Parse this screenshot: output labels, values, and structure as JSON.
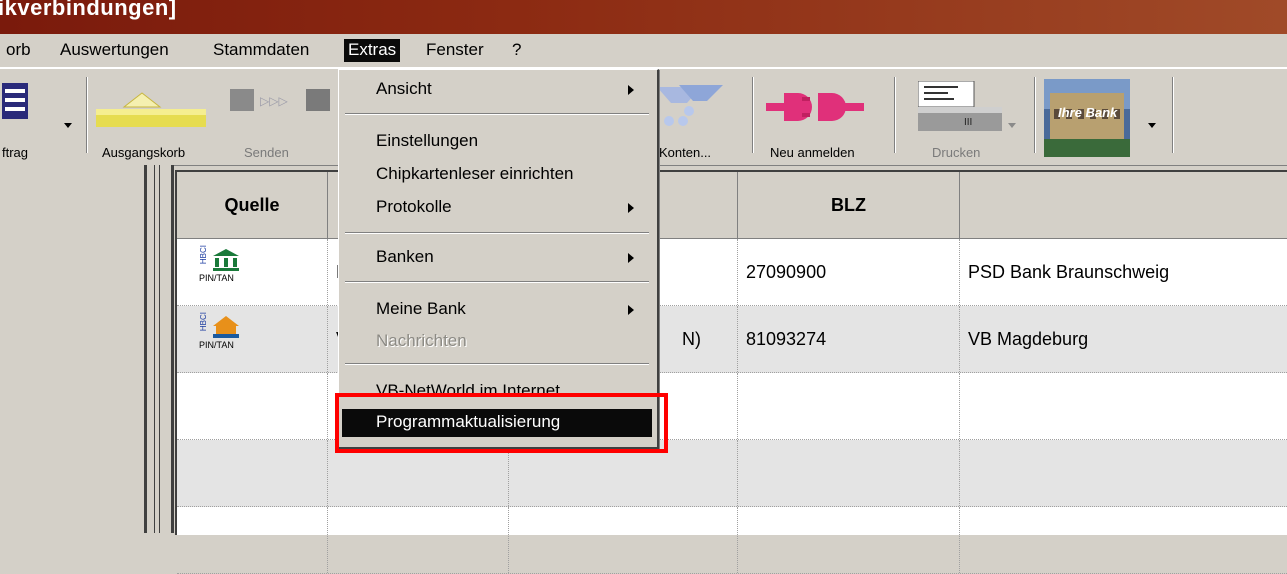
{
  "window": {
    "title": "ikverbindungen]"
  },
  "menubar": {
    "items": [
      {
        "label": "orb"
      },
      {
        "label": "Auswertungen"
      },
      {
        "label": "Stammdaten"
      },
      {
        "label": "Extras"
      },
      {
        "label": "Fenster"
      },
      {
        "label": "?"
      }
    ],
    "active": "Extras"
  },
  "toolbar": {
    "auftrag_label": "ftrag",
    "ausgangskorb_label": "Ausgangskorb",
    "senden_label": "Senden",
    "konten_label": "Konten...",
    "neuanmelden_label": "Neu anmelden",
    "drucken_label": "Drucken",
    "bank_logo_text": "Ihre Bank"
  },
  "extras_menu": {
    "items": [
      {
        "label": "Ansicht",
        "submenu": true
      },
      {
        "label": "Einstellungen"
      },
      {
        "label": "Chipkartenleser einrichten"
      },
      {
        "label": "Protokolle",
        "submenu": true
      },
      {
        "label": "Banken",
        "submenu": true
      },
      {
        "label": "Meine Bank",
        "submenu": true
      },
      {
        "label": "Nachrichten",
        "disabled": true
      },
      {
        "label": "VB-NetWorld im Internet"
      },
      {
        "label": "Programmaktualisierung",
        "selected": true
      }
    ]
  },
  "grid": {
    "columns": [
      "Quelle",
      "",
      "",
      "BLZ",
      ""
    ],
    "rows": [
      {
        "source": "PIN/TAN",
        "hbci": "HBCI",
        "name_fragment": "P",
        "account_fragment": "",
        "blz": "27090900",
        "bank": "PSD Bank Braunschweig"
      },
      {
        "source": "PIN/TAN",
        "hbci": "HBCI",
        "name_fragment": "V",
        "account_fragment": "N)",
        "blz": "81093274",
        "bank": "VB Magdeburg"
      }
    ]
  },
  "colors": {
    "highlight": "#ff0000",
    "menu_selected": "#0a0a0a",
    "face": "#d4d0c8"
  }
}
